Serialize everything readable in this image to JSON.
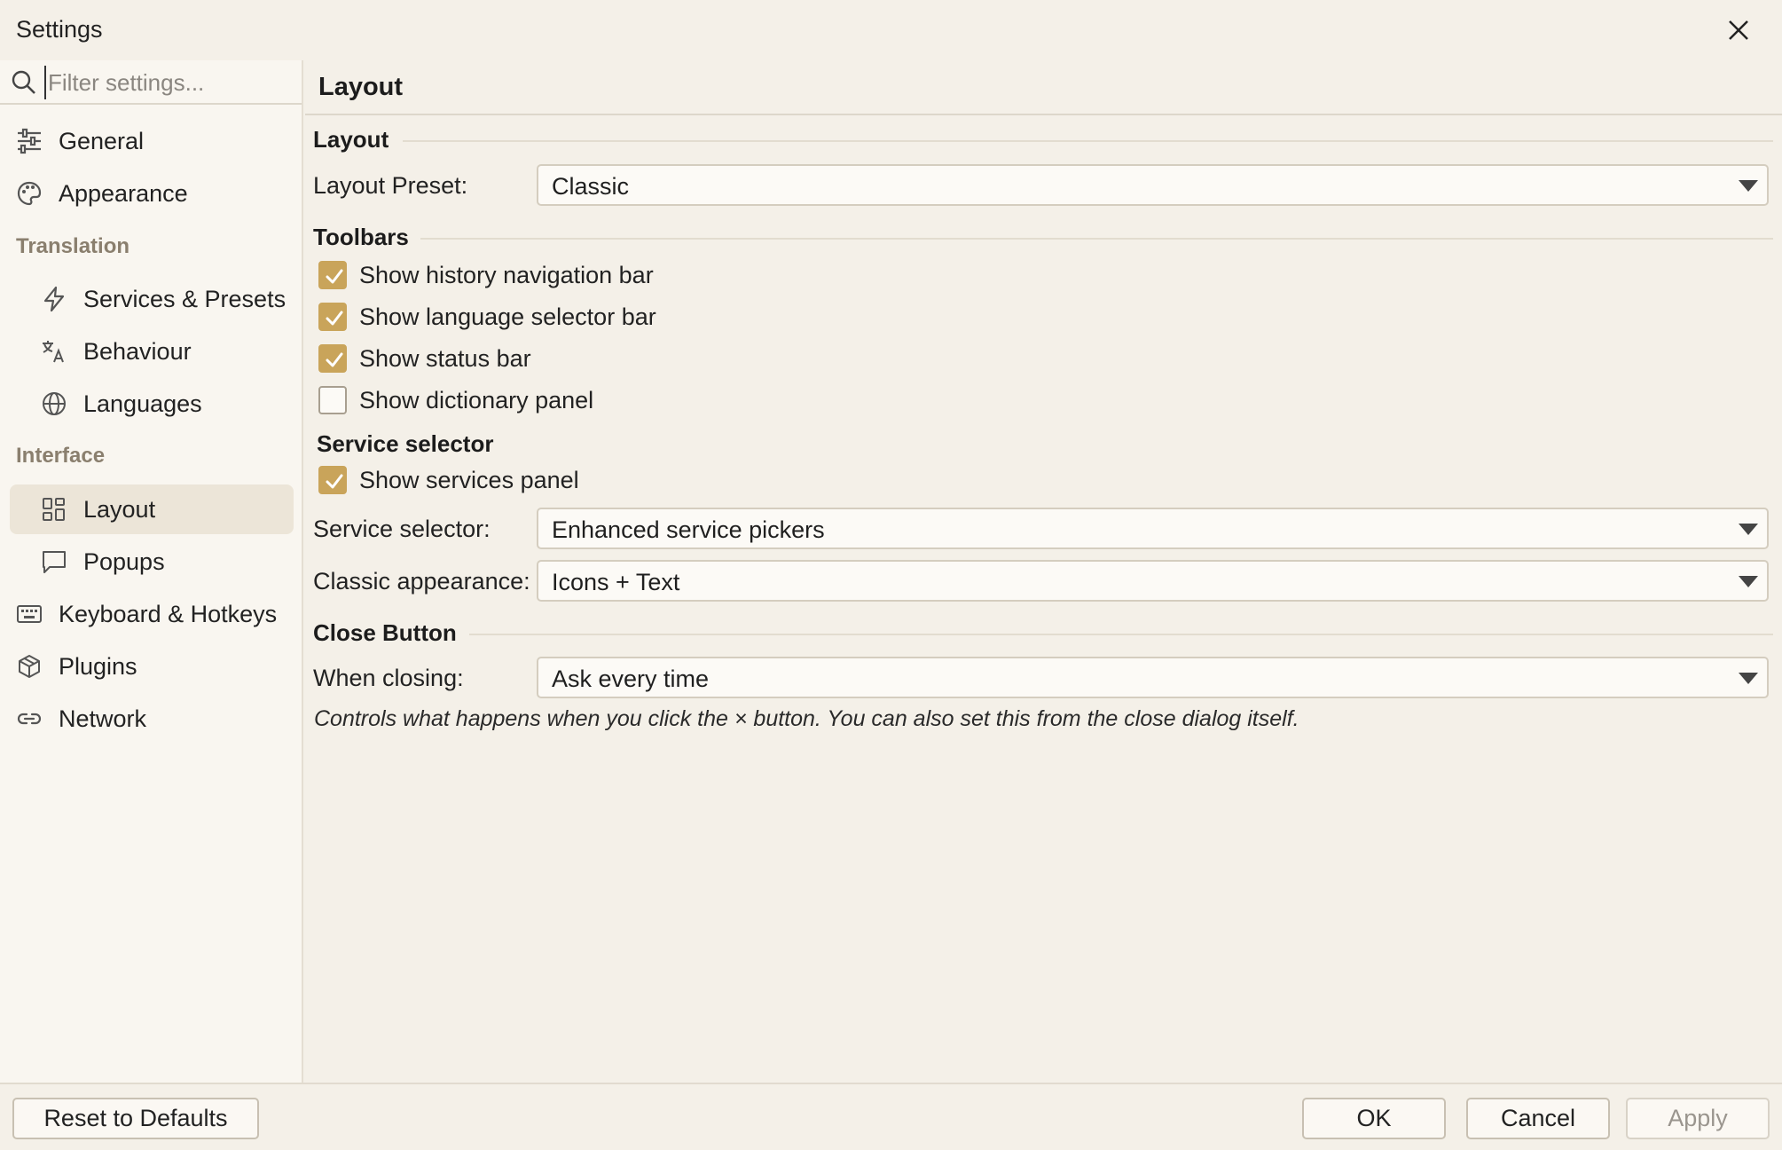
{
  "window": {
    "title": "Settings"
  },
  "sidebar": {
    "search_placeholder": "Filter settings...",
    "items": [
      {
        "label": "General",
        "icon": "sliders-icon"
      },
      {
        "label": "Appearance",
        "icon": "palette-icon"
      },
      {
        "group": "Translation"
      },
      {
        "label": "Services & Presets",
        "icon": "lightning-icon"
      },
      {
        "label": "Behaviour",
        "icon": "translate-icon"
      },
      {
        "label": "Languages",
        "icon": "globe-icon"
      },
      {
        "group": "Interface"
      },
      {
        "label": "Layout",
        "icon": "grid-icon",
        "active": true
      },
      {
        "label": "Popups",
        "icon": "chat-bubble-icon"
      },
      {
        "label": "Keyboard & Hotkeys",
        "icon": "keyboard-icon"
      },
      {
        "label": "Plugins",
        "icon": "package-icon"
      },
      {
        "label": "Network",
        "icon": "link-icon"
      }
    ]
  },
  "main": {
    "header": "Layout",
    "layout_group": {
      "title": "Layout",
      "preset_label": "Layout Preset:",
      "preset_value": "Classic"
    },
    "toolbars_group": {
      "title": "Toolbars",
      "options": [
        {
          "label": "Show history navigation bar",
          "checked": true
        },
        {
          "label": "Show language selector bar",
          "checked": true
        },
        {
          "label": "Show status bar",
          "checked": true
        },
        {
          "label": "Show dictionary panel",
          "checked": false
        }
      ]
    },
    "service_selector_group": {
      "title": "Service selector",
      "show_panel_label": "Show services panel",
      "show_panel_checked": true,
      "selector_label": "Service selector:",
      "selector_value": "Enhanced service pickers",
      "appearance_label": "Classic appearance:",
      "appearance_value": "Icons + Text"
    },
    "close_group": {
      "title": "Close Button",
      "closing_label": "When closing:",
      "closing_value": "Ask every time",
      "hint": "Controls what happens when you click the × button. You can also set this from the close dialog itself."
    }
  },
  "footer": {
    "reset_label": "Reset to Defaults",
    "ok_label": "OK",
    "cancel_label": "Cancel",
    "apply_label": "Apply"
  },
  "colors": {
    "accent": "#c9a45a",
    "background": "#f4f0e8",
    "sidebar_bg": "#f9f6f0",
    "active_item_bg": "#ece5d8"
  }
}
